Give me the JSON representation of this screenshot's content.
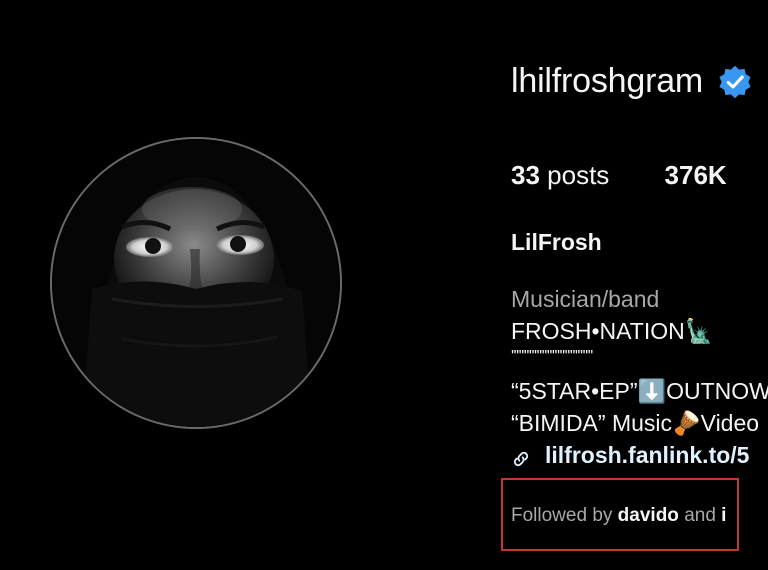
{
  "profile": {
    "username": "lhilfroshgram",
    "verified_icon": "verified-badge-icon",
    "avatar_icon": "profile-photo",
    "stats": {
      "posts_count": "33",
      "posts_label": "posts",
      "followers_count": "376K"
    },
    "display_name": "LilFrosh",
    "bio": {
      "category": "Musician/band",
      "line1": "FROSH•NATION🗽",
      "line2": "''''''''''''''''''''''''''''''''",
      "line3": "“5STAR•EP”⬇️OUTNOW",
      "line4": "“BIMIDA” Music🪘Video",
      "link": "lilfrosh.fanlink.to/5"
    },
    "followed_by": {
      "prefix": "Followed by",
      "user": "davido",
      "suffix": "and",
      "next": "i"
    }
  },
  "colors": {
    "background": "#000000",
    "text": "#f5f5f5",
    "muted": "#a8a8a8",
    "verified_blue": "#3897f0",
    "highlight_red": "#c0392b"
  }
}
